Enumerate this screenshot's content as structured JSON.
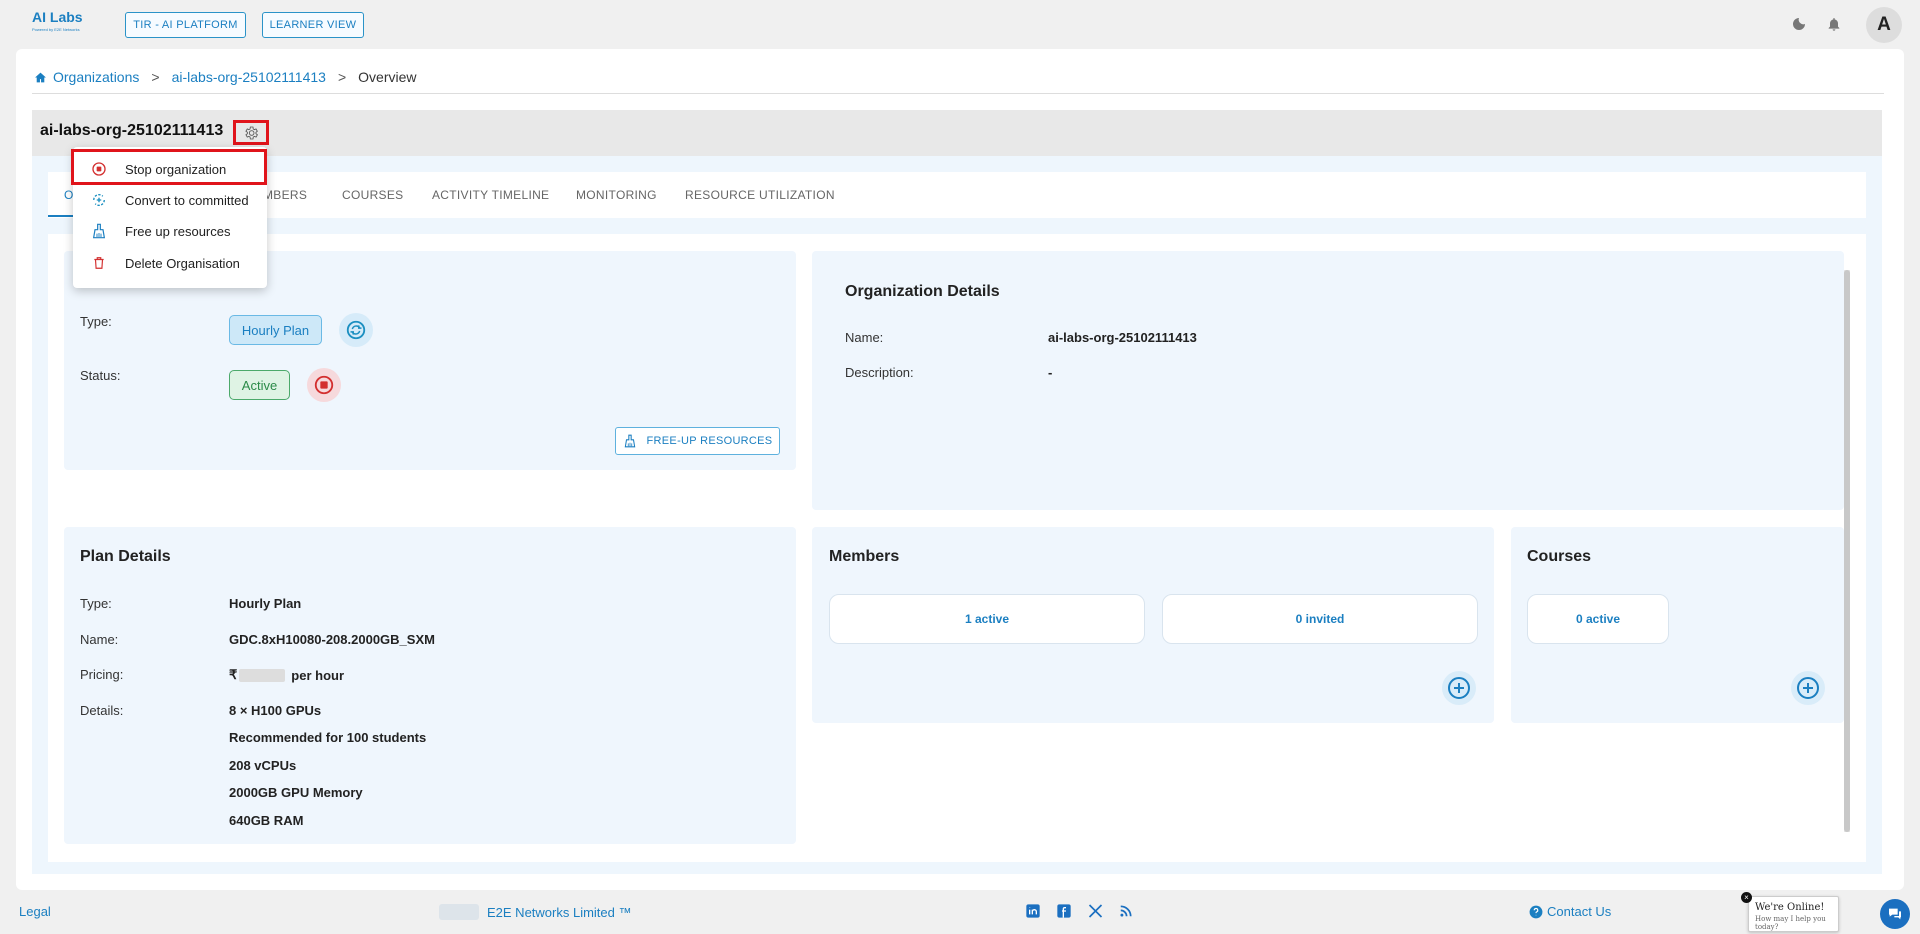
{
  "header": {
    "logo_main": "AI Labs",
    "logo_sub": "Powered by E2E Networks",
    "btn_platform": "TIR - AI PLATFORM",
    "btn_learner": "LEARNER VIEW",
    "avatar_letter": "A"
  },
  "breadcrumb": {
    "home": "Organizations",
    "sep1": ">",
    "org": "ai-labs-org-25102111413",
    "sep2": ">",
    "current": "Overview"
  },
  "org": {
    "title": "ai-labs-org-25102111413"
  },
  "tabs": [
    {
      "label": "O"
    },
    {
      "label": "MBERS"
    },
    {
      "label": "COURSES"
    },
    {
      "label": "ACTIVITY TIMELINE"
    },
    {
      "label": "MONITORING"
    },
    {
      "label": "RESOURCE UTILIZATION"
    }
  ],
  "menu": {
    "items": [
      {
        "label": "Stop organization"
      },
      {
        "label": "Convert to committed"
      },
      {
        "label": "Free up resources"
      },
      {
        "label": "Delete Organisation"
      }
    ]
  },
  "status_panel": {
    "type_label": "Type:",
    "type_value": "Hourly Plan",
    "status_label": "Status:",
    "status_value": "Active",
    "free_button": "FREE-UP RESOURCES"
  },
  "org_details": {
    "title": "Organization Details",
    "name_label": "Name:",
    "name_value": "ai-labs-org-25102111413",
    "desc_label": "Description:",
    "desc_value": "-"
  },
  "plan": {
    "title": "Plan Details",
    "type_label": "Type:",
    "type_value": "Hourly Plan",
    "name_label": "Name:",
    "name_value": "GDC.8xH10080-208.2000GB_SXM",
    "pricing_label": "Pricing:",
    "pricing_currency": "₹",
    "pricing_suffix": "per hour",
    "details_label": "Details:",
    "details": [
      "8 × H100 GPUs",
      "Recommended for 100 students",
      "208 vCPUs",
      "2000GB GPU Memory",
      "640GB RAM"
    ]
  },
  "members": {
    "title": "Members",
    "active": "1 active",
    "invited": "0 invited"
  },
  "courses": {
    "title": "Courses",
    "active": "0 active"
  },
  "footer": {
    "legal": "Legal",
    "company": "E2E Networks Limited ™",
    "contact": "Contact Us"
  },
  "chat": {
    "title": "We're Online!",
    "subtitle": "How may I help you today?"
  },
  "colors": {
    "accent": "#1b7fc1",
    "highlight": "#e0141b",
    "danger": "#d32f2f"
  }
}
